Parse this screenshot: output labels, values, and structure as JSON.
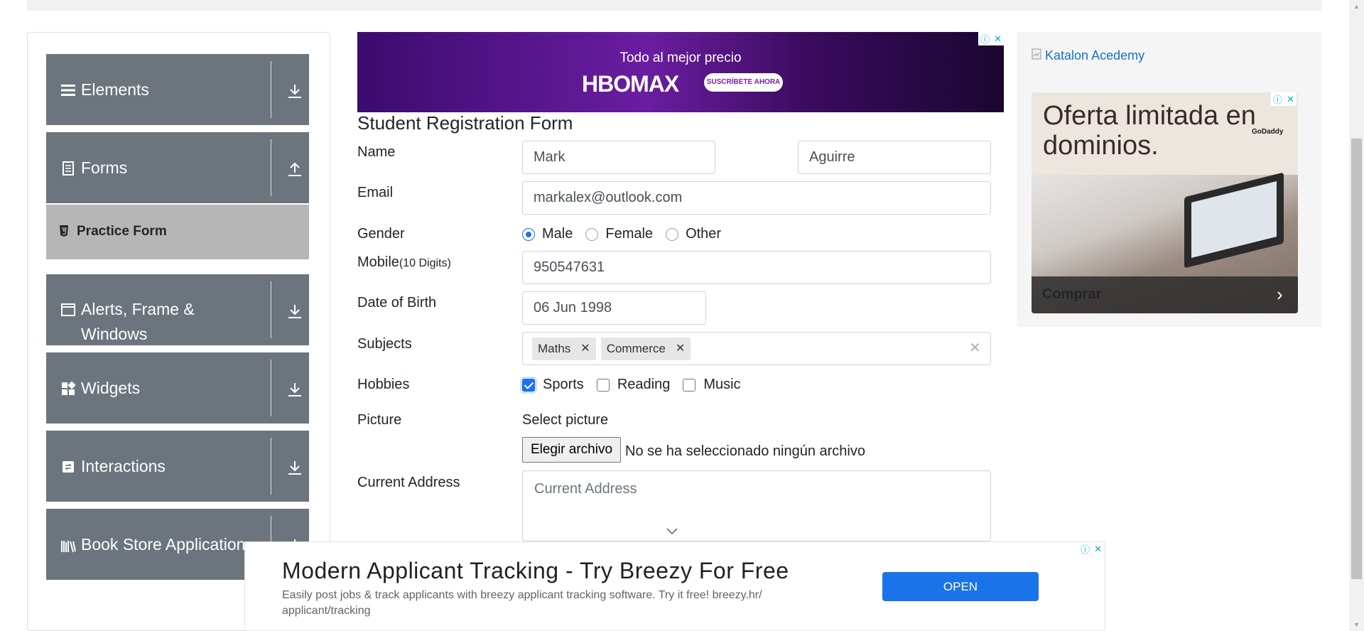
{
  "sidebar": {
    "groups": [
      {
        "label": "Elements",
        "icon": "menu-icon",
        "arrow": "download-icon"
      },
      {
        "label": "Forms",
        "icon": "document-icon",
        "arrow": "upload-icon"
      },
      {
        "label": "Alerts, Frame &",
        "label2": "Windows",
        "icon": "window-icon",
        "arrow": "download-icon"
      },
      {
        "label": "Widgets",
        "icon": "widgets-icon",
        "arrow": "download-icon"
      },
      {
        "label": "Interactions",
        "icon": "interactions-icon",
        "arrow": "download-icon"
      },
      {
        "label": "Book Store Application",
        "icon": "books-icon",
        "arrow": "download-icon"
      }
    ],
    "active_item": {
      "label": "Practice Form",
      "icon": "html5-icon"
    }
  },
  "ads": {
    "hbo": {
      "headline": "Todo al mejor precio",
      "logo": "HBOMAX",
      "cta": "SUSCRÍBETE AHORA"
    },
    "katalon": {
      "link": "Katalon Acedemy"
    },
    "godaddy": {
      "headline": "Oferta limitada en dominios.",
      "brand": "GoDaddy",
      "cta": "Comprar"
    },
    "breezy": {
      "title": "Modern Applicant Tracking - Try Breezy For Free",
      "description": "Easily post jobs & track applicants with breezy applicant tracking software. Try it free! breezy.hr/ applicant/tracking",
      "cta": "OPEN"
    }
  },
  "form": {
    "title": "Student Registration Form",
    "name_label": "Name",
    "first_name": "Mark",
    "last_name": "Aguirre",
    "email_label": "Email",
    "email": "markalex@outlook.com",
    "gender_label": "Gender",
    "genders": [
      "Male",
      "Female",
      "Other"
    ],
    "gender_selected": "Male",
    "mobile_label": "Mobile",
    "mobile_hint": "(10 Digits)",
    "mobile": "950547631",
    "dob_label": "Date of Birth",
    "dob": "06 Jun 1998",
    "subjects_label": "Subjects",
    "subjects": [
      "Maths",
      "Commerce"
    ],
    "hobbies_label": "Hobbies",
    "hobbies": [
      "Sports",
      "Reading",
      "Music"
    ],
    "hobbies_checked": [
      "Sports"
    ],
    "picture_label": "Picture",
    "picture_caption": "Select picture",
    "file_button": "Elegir archivo",
    "file_status": "No se ha seleccionado ningún archivo",
    "address_label": "Current Address",
    "address_placeholder": "Current Address"
  },
  "colors": {
    "nav_bg": "#6c757d",
    "active_bg": "#b6b6b6",
    "accent": "#1a73e8"
  }
}
